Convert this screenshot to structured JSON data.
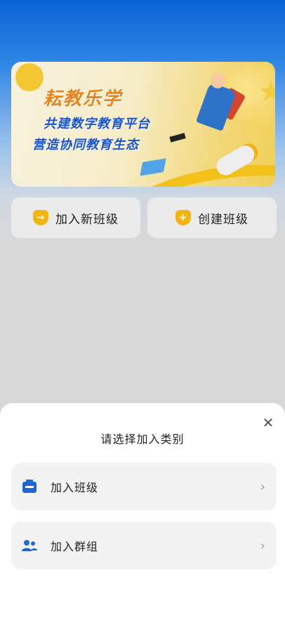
{
  "banner": {
    "title": "耘教乐学",
    "line1": "共建数字教育平台",
    "line2": "营造协同教育生态"
  },
  "actions": {
    "join_class": "加入新班级",
    "create_class": "创建班级"
  },
  "sheet": {
    "heading": "请选择加入类别",
    "options": [
      {
        "label": "加入班级",
        "icon": "class-icon"
      },
      {
        "label": "加入群组",
        "icon": "group-icon"
      }
    ]
  },
  "colors": {
    "accent_blue": "#1f66d6",
    "badge_yellow": "#f2b50f"
  }
}
